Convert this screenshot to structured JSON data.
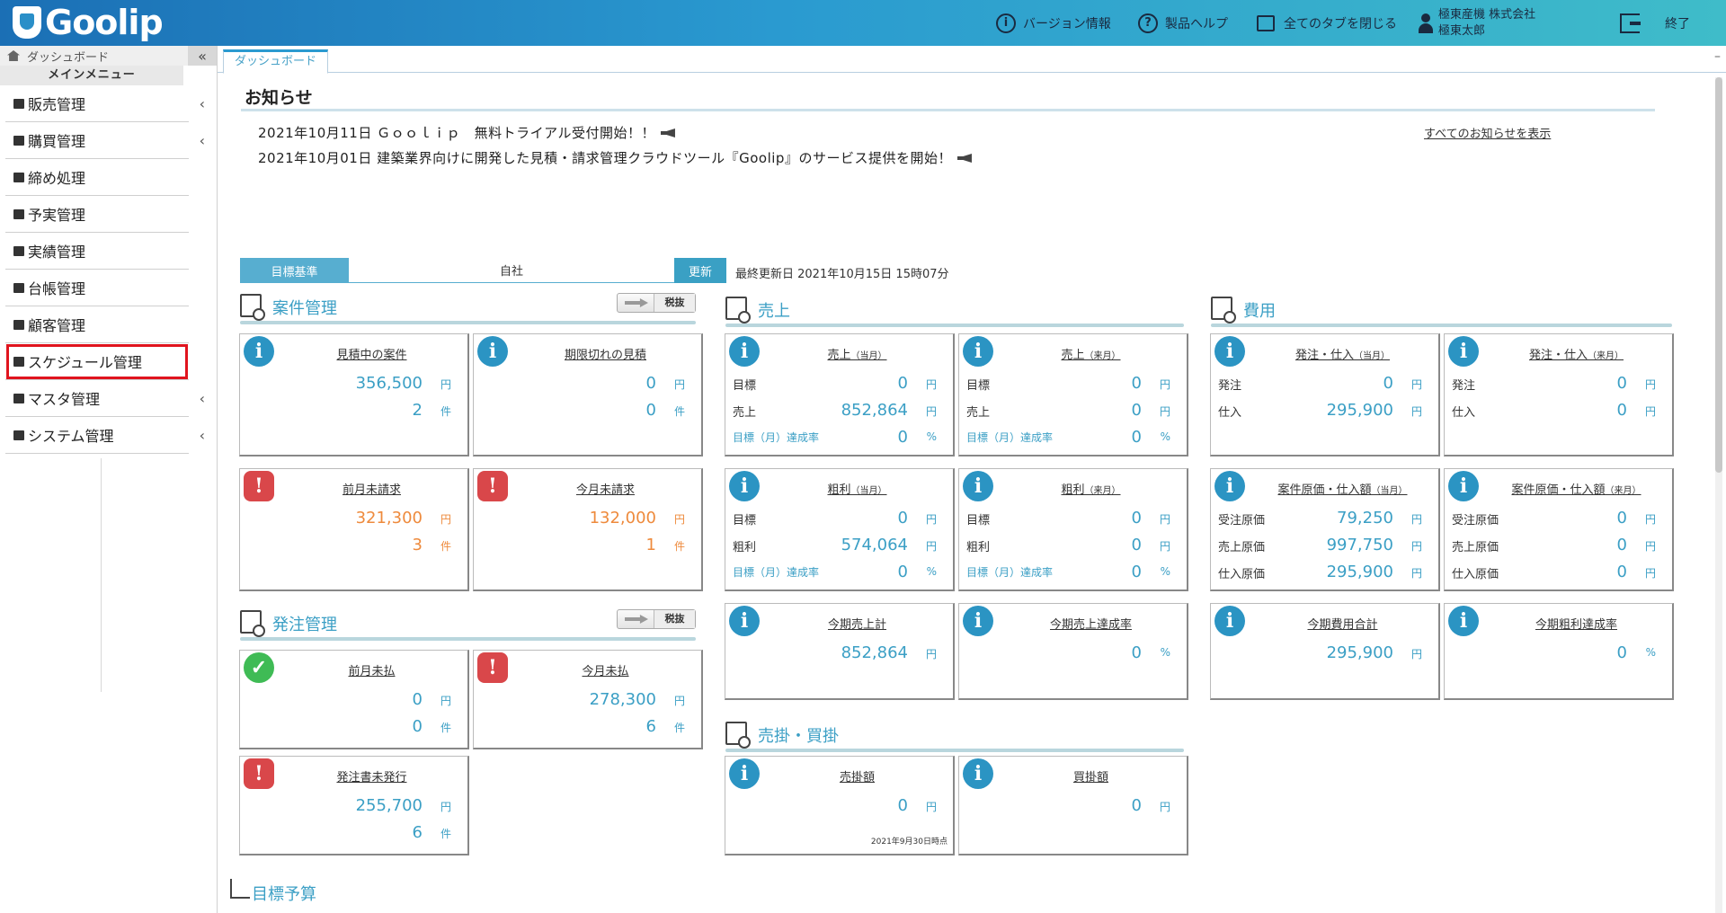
{
  "header": {
    "logo": "Goolip",
    "version_info": "バージョン情報",
    "help": "製品ヘルプ",
    "close_tabs": "全てのタブを閉じる",
    "company": "極東産機 株式会社",
    "user": "極東太郎",
    "exit": "終了"
  },
  "sidebar": {
    "breadcrumb": "ダッシュボード",
    "collapse_icon": "«",
    "title": "メインメニュー",
    "items": [
      {
        "label": "販売管理",
        "chevron": "‹"
      },
      {
        "label": "購買管理",
        "chevron": "‹"
      },
      {
        "label": "締め処理"
      },
      {
        "label": "予実管理"
      },
      {
        "label": "実績管理"
      },
      {
        "label": "台帳管理"
      },
      {
        "label": "顧客管理"
      },
      {
        "label": "スケジュール管理"
      },
      {
        "label": "マスタ管理",
        "chevron": "‹"
      },
      {
        "label": "システム管理",
        "chevron": "‹"
      }
    ]
  },
  "tabs": {
    "active": "ダッシュボード",
    "minimize": "–"
  },
  "notices": {
    "title": "お知らせ",
    "items": [
      "2021年10月11日 Ｇｏｏｌｉｐ　無料トライアル受付開始！！",
      "2021年10月01日 建築業界向けに開発した見積・請求管理クラウドツール『Goolip』のサービス提供を開始！"
    ],
    "show_all": "すべてのお知らせを表示"
  },
  "basis": {
    "label": "目標基準",
    "value": "自社",
    "update_button": "更新",
    "last_updated": "最終更新日 2021年10月15日 15時07分"
  },
  "sections": {
    "projects": {
      "title": "案件管理",
      "tax": "税抜"
    },
    "sales": {
      "title": "売上"
    },
    "costs": {
      "title": "費用"
    },
    "orders": {
      "title": "発注管理",
      "tax": "税抜"
    },
    "receivables": {
      "title": "売掛・買掛"
    },
    "target": {
      "title": "目標予算"
    }
  },
  "cards": {
    "estimates": {
      "title": "見積中の案件",
      "amount": "356,500",
      "amount_unit": "円",
      "count": "2",
      "count_unit": "件"
    },
    "expired": {
      "title": "期限切れの見積",
      "amount": "0",
      "amount_unit": "円",
      "count": "0",
      "count_unit": "件"
    },
    "last_unbilled": {
      "title": "前月未請求",
      "amount": "321,300",
      "amount_unit": "円",
      "count": "3",
      "count_unit": "件"
    },
    "this_unbilled": {
      "title": "今月未請求",
      "amount": "132,000",
      "amount_unit": "円",
      "count": "1",
      "count_unit": "件"
    },
    "sales_current": {
      "title": "売上",
      "suffix": "（当月）",
      "l1": "目標",
      "v1": "0",
      "u1": "円",
      "l2": "売上",
      "v2": "852,864",
      "u2": "円",
      "l3": "目標（月）達成率",
      "v3": "0",
      "u3": "%"
    },
    "sales_next": {
      "title": "売上",
      "suffix": "（来月）",
      "l1": "目標",
      "v1": "0",
      "u1": "円",
      "l2": "売上",
      "v2": "0",
      "u2": "円",
      "l3": "目標（月）達成率",
      "v3": "0",
      "u3": "%"
    },
    "gross_current": {
      "title": "粗利",
      "suffix": "（当月）",
      "l1": "目標",
      "v1": "0",
      "u1": "円",
      "l2": "粗利",
      "v2": "574,064",
      "u2": "円",
      "l3": "目標（月）達成率",
      "v3": "0",
      "u3": "%"
    },
    "gross_next": {
      "title": "粗利",
      "suffix": "（来月）",
      "l1": "目標",
      "v1": "0",
      "u1": "円",
      "l2": "粗利",
      "v2": "0",
      "u2": "円",
      "l3": "目標（月）達成率",
      "v3": "0",
      "u3": "%"
    },
    "term_sales": {
      "title": "今期売上計",
      "amount": "852,864",
      "unit": "円"
    },
    "term_sales_rate": {
      "title": "今期売上達成率",
      "amount": "0",
      "unit": "%"
    },
    "po_current": {
      "title": "発注・仕入",
      "suffix": "（当月）",
      "l1": "発注",
      "v1": "0",
      "u1": "円",
      "l2": "仕入",
      "v2": "295,900",
      "u2": "円"
    },
    "po_next": {
      "title": "発注・仕入",
      "suffix": "（来月）",
      "l1": "発注",
      "v1": "0",
      "u1": "円",
      "l2": "仕入",
      "v2": "0",
      "u2": "円"
    },
    "cost_current": {
      "title": "案件原価・仕入額",
      "suffix": "（当月）",
      "l1": "受注原価",
      "v1": "79,250",
      "u1": "円",
      "l2": "売上原価",
      "v2": "997,750",
      "u2": "円",
      "l3": "仕入原価",
      "v3": "295,900",
      "u3": "円"
    },
    "cost_next": {
      "title": "案件原価・仕入額",
      "suffix": "（来月）",
      "l1": "受注原価",
      "v1": "0",
      "u1": "円",
      "l2": "売上原価",
      "v2": "0",
      "u2": "円",
      "l3": "仕入原価",
      "v3": "0",
      "u3": "円"
    },
    "term_costs": {
      "title": "今期費用合計",
      "amount": "295,900",
      "unit": "円"
    },
    "term_gross_rate": {
      "title": "今期粗利達成率",
      "amount": "0",
      "unit": "%"
    },
    "last_unpaid": {
      "title": "前月未払",
      "amount": "0",
      "amount_unit": "円",
      "count": "0",
      "count_unit": "件"
    },
    "this_unpaid": {
      "title": "今月未払",
      "amount": "278,300",
      "amount_unit": "円",
      "count": "6",
      "count_unit": "件"
    },
    "po_unissued": {
      "title": "発注書未発行",
      "amount": "255,700",
      "amount_unit": "円",
      "count": "6",
      "count_unit": "件"
    },
    "receivable": {
      "title": "売掛額",
      "amount": "0",
      "unit": "円",
      "note": "2021年9月30日時点"
    },
    "payable": {
      "title": "買掛額",
      "amount": "0",
      "unit": "円"
    }
  },
  "icons": {
    "info": "i",
    "warn": "!",
    "ok": "✓"
  },
  "colors": {
    "accent": "#3b9fc5",
    "warning": "#ee8a3c",
    "alert_icon": "#d9474a",
    "ok_icon": "#3fbb55",
    "highlight": "#e0141e"
  }
}
